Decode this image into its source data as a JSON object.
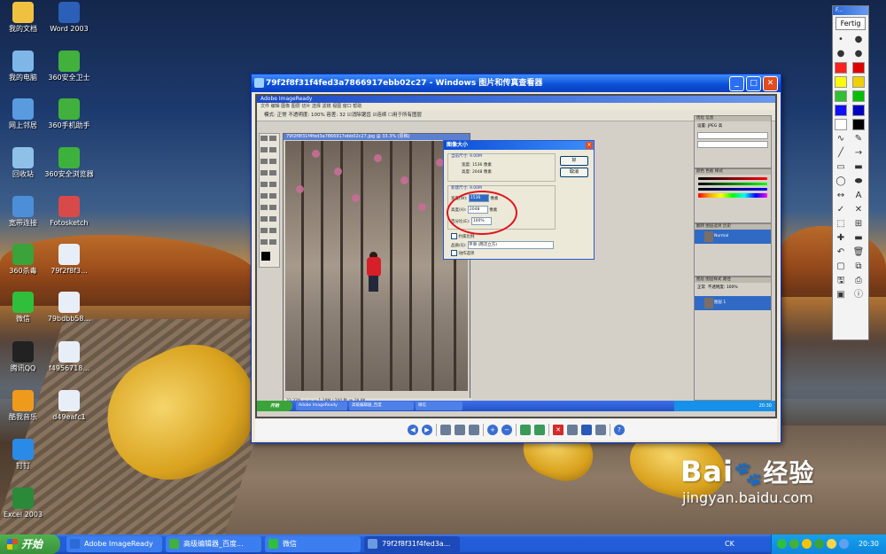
{
  "desktop": {
    "icons": [
      {
        "label": "我的文档",
        "icon": "folder-icon",
        "color": "#f0c040"
      },
      {
        "label": "Word 2003",
        "icon": "word-icon",
        "color": "#2b5fb8"
      },
      {
        "label": "我的电脑",
        "icon": "computer-icon",
        "color": "#7fb6e8"
      },
      {
        "label": "360安全卫士",
        "icon": "shield-icon",
        "color": "#41b03c"
      },
      {
        "label": "网上邻居",
        "icon": "network-icon",
        "color": "#5a9be0"
      },
      {
        "label": "360手机助手",
        "icon": "phone-icon",
        "color": "#41b03c"
      },
      {
        "label": "回收站",
        "icon": "recycle-bin-icon",
        "color": "#8fc0e8"
      },
      {
        "label": "360安全浏览器",
        "icon": "browser-icon",
        "color": "#3cb23c"
      },
      {
        "label": "宽带连接",
        "icon": "connection-icon",
        "color": "#4d8ed8"
      },
      {
        "label": "Fotosketch",
        "icon": "fotosketch-icon",
        "color": "#d84a4a"
      },
      {
        "label": "360杀毒",
        "icon": "antivirus-icon",
        "color": "#3aa33a"
      },
      {
        "label": "79f2f8f3...",
        "icon": "image-file-icon",
        "color": "#e8eef8"
      },
      {
        "label": "微信",
        "icon": "wechat-icon",
        "color": "#2fbf3c"
      },
      {
        "label": "79bdbb58...",
        "icon": "image-file-icon",
        "color": "#e8eef8"
      },
      {
        "label": "腾讯QQ",
        "icon": "qq-icon",
        "color": "#222222"
      },
      {
        "label": "f4956718...",
        "icon": "image-file-icon",
        "color": "#e8eef8"
      },
      {
        "label": "酷我音乐",
        "icon": "music-icon",
        "color": "#f09a1c"
      },
      {
        "label": "d49eafc1",
        "icon": "image-file-icon",
        "color": "#e8eef8"
      },
      {
        "label": "钉钉",
        "icon": "dingtalk-icon",
        "color": "#2a8ae8"
      },
      {
        "label": "Excel 2003",
        "icon": "excel-icon",
        "color": "#2a8a3a"
      }
    ]
  },
  "viewer": {
    "title": "79f2f8f31f4fed3a7866917ebb02c27 - Windows 图片和传真查看器",
    "imageready": {
      "title": "Adobe ImageReady",
      "menu": "文件  编辑  图像  图层  切片  选择  滤镜  视图  窗口  帮助",
      "options": "模式: 正常   不透明度: 100%   容差: 32   ☑消除锯齿   ☑连续   ☐用于所有图层",
      "doc_title": "79f2f8f31f4fed3a7866917ebb02c27.jpg @ 33.3% (原稿)",
      "doc_status": "33.33%  —  —  —  1.18M / 200 秒 @ 28.8K",
      "dialog": {
        "title": "图像大小",
        "orig_label": "当前尺寸: 9.00M",
        "orig_width": "宽度: 1536 像素",
        "orig_height": "高度: 2048 像素",
        "new_label": "新建尺寸: 9.00M",
        "width_label": "宽度(W):",
        "width_value": "1536",
        "height_label": "高度(H):",
        "height_value": "2048",
        "percent_label": "百分比(E):",
        "percent_value": "100%",
        "unit": "像素",
        "constrain": "约束比例",
        "quality_label": "品质(Q):",
        "quality_value": "平滑 (两次立方)",
        "action": "动作选项",
        "ok": "好",
        "cancel": "取消"
      },
      "panels": {
        "optimize": "优化  信息",
        "optimize_format": "设置: JPEG 高",
        "color": "颜色  色板  样式",
        "history": "翻转  图层选项  历史",
        "history_item": "Normal",
        "layers": "图层  图层样式  路径",
        "layers_mode": "正常",
        "layers_opacity": "不透明度: 100%",
        "layer_name": "图层 1"
      },
      "taskbar": {
        "start": "开始",
        "items": [
          "Adobe ImageReady",
          "高级编辑器_百度",
          "微信"
        ],
        "clock": "20:30"
      }
    }
  },
  "toolbox": {
    "title": "F...",
    "fertig": "Fertig",
    "colors": [
      "#ff2020",
      "#e00000",
      "#ffff00",
      "#f0d000",
      "#30c030",
      "#00c000",
      "#1010ff",
      "#0000c0",
      "#ffffff",
      "#000000"
    ]
  },
  "taskbar": {
    "start_label": "开始",
    "tasks": [
      {
        "label": "Adobe ImageReady",
        "color": "#2b6bd6"
      },
      {
        "label": "高级编辑器_百度...",
        "color": "#41b03c"
      },
      {
        "label": "微信",
        "color": "#2fbf3c"
      },
      {
        "label": "79f2f8f31f4fed3a...",
        "color": "#6a9be0"
      }
    ],
    "lang": "CK",
    "clock": "20:30"
  },
  "watermark": {
    "brand": "Bai",
    "brand2": "经验",
    "url": "jingyan.baidu.com"
  }
}
